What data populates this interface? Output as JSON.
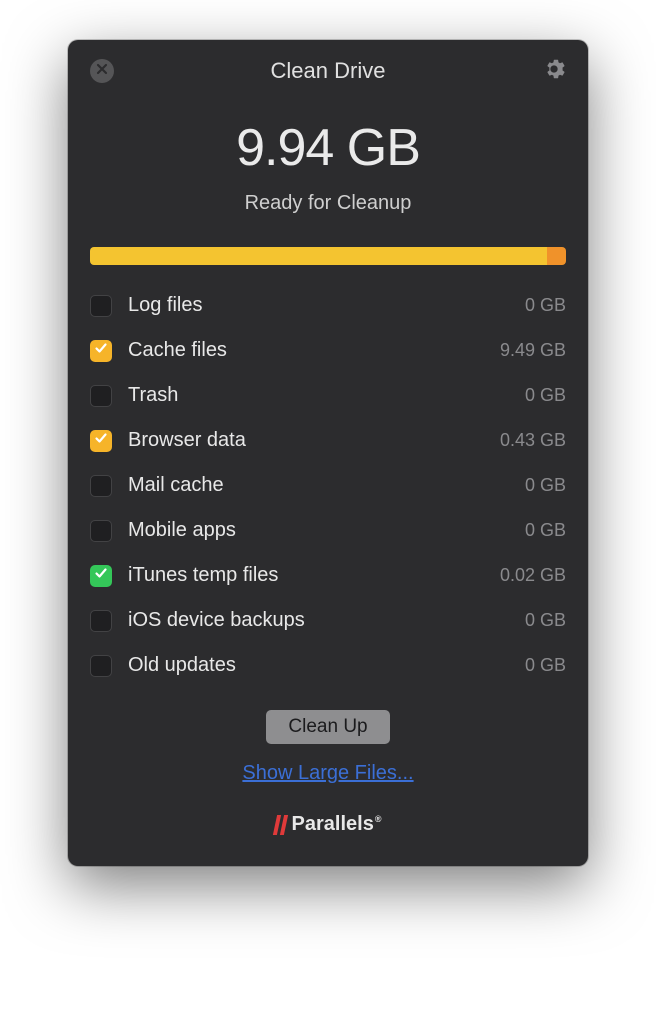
{
  "header": {
    "title": "Clean Drive"
  },
  "hero": {
    "size": "9.94 GB",
    "subtitle": "Ready for Cleanup"
  },
  "progress": {
    "main_pct": 96,
    "end_pct": 4
  },
  "items": [
    {
      "label": "Log files",
      "size": "0 GB",
      "checked": false,
      "color": ""
    },
    {
      "label": "Cache files",
      "size": "9.49 GB",
      "checked": true,
      "color": "orange"
    },
    {
      "label": "Trash",
      "size": "0 GB",
      "checked": false,
      "color": ""
    },
    {
      "label": "Browser data",
      "size": "0.43 GB",
      "checked": true,
      "color": "orange"
    },
    {
      "label": "Mail cache",
      "size": "0 GB",
      "checked": false,
      "color": ""
    },
    {
      "label": "Mobile apps",
      "size": "0 GB",
      "checked": false,
      "color": ""
    },
    {
      "label": "iTunes temp files",
      "size": "0.02 GB",
      "checked": true,
      "color": "green"
    },
    {
      "label": "iOS device backups",
      "size": "0 GB",
      "checked": false,
      "color": ""
    },
    {
      "label": "Old updates",
      "size": "0 GB",
      "checked": false,
      "color": ""
    }
  ],
  "actions": {
    "cleanup_label": "Clean Up",
    "link_label": "Show Large Files..."
  },
  "brand": {
    "name": "Parallels"
  }
}
